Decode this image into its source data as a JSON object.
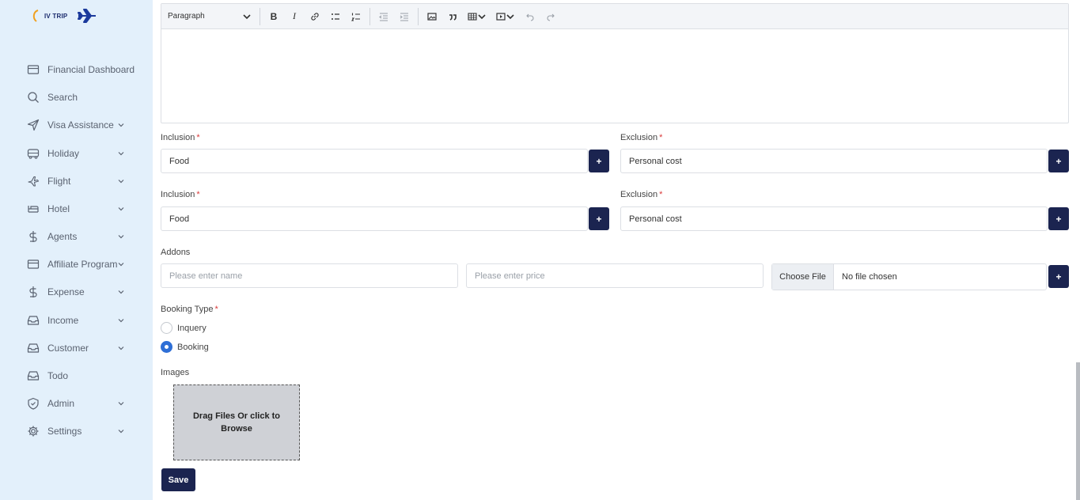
{
  "brand": {
    "logo_text": "IV TRIP",
    "accent": "#1b2450",
    "sidebar_bg": "#e3f0fb"
  },
  "sidebar": {
    "items": [
      {
        "label": "Financial Dashboard",
        "icon": "card-icon",
        "has_chevron": false
      },
      {
        "label": "Search",
        "icon": "search-icon",
        "has_chevron": false
      },
      {
        "label": "Visa Assistance",
        "icon": "send-icon",
        "has_chevron": true
      },
      {
        "label": "Holiday",
        "icon": "bus-icon",
        "has_chevron": true
      },
      {
        "label": "Flight",
        "icon": "plane-icon",
        "has_chevron": true
      },
      {
        "label": "Hotel",
        "icon": "bed-icon",
        "has_chevron": true
      },
      {
        "label": "Agents",
        "icon": "dollar-icon",
        "has_chevron": true
      },
      {
        "label": "Affiliate Program",
        "icon": "card-icon",
        "has_chevron": true
      },
      {
        "label": "Expense",
        "icon": "dollar-icon",
        "has_chevron": true
      },
      {
        "label": "Income",
        "icon": "inbox-icon",
        "has_chevron": true
      },
      {
        "label": "Customer",
        "icon": "inbox-icon",
        "has_chevron": true
      },
      {
        "label": "Todo",
        "icon": "inbox-icon",
        "has_chevron": false
      },
      {
        "label": "Admin",
        "icon": "shield-icon",
        "has_chevron": true
      },
      {
        "label": "Settings",
        "icon": "gear-icon",
        "has_chevron": true
      }
    ]
  },
  "editor": {
    "paragraph_select": "Paragraph"
  },
  "form": {
    "rows": [
      {
        "inclusion_label": "Inclusion",
        "inclusion_value": "Food",
        "exclusion_label": "Exclusion",
        "exclusion_value": "Personal cost"
      },
      {
        "inclusion_label": "Inclusion",
        "inclusion_value": "Food",
        "exclusion_label": "Exclusion",
        "exclusion_value": "Personal cost"
      }
    ],
    "required_mark": "*",
    "plus_label": "+",
    "addons": {
      "label": "Addons",
      "name_placeholder": "Please enter name",
      "price_placeholder": "Please enter price",
      "file_button": "Choose File",
      "file_status": "No file chosen"
    },
    "booking_type": {
      "label": "Booking Type",
      "options": [
        {
          "label": "Inquery",
          "checked": false
        },
        {
          "label": "Booking",
          "checked": true
        }
      ]
    },
    "images": {
      "label": "Images",
      "dropzone_text": "Drag Files Or click to Browse"
    },
    "save_label": "Save"
  }
}
